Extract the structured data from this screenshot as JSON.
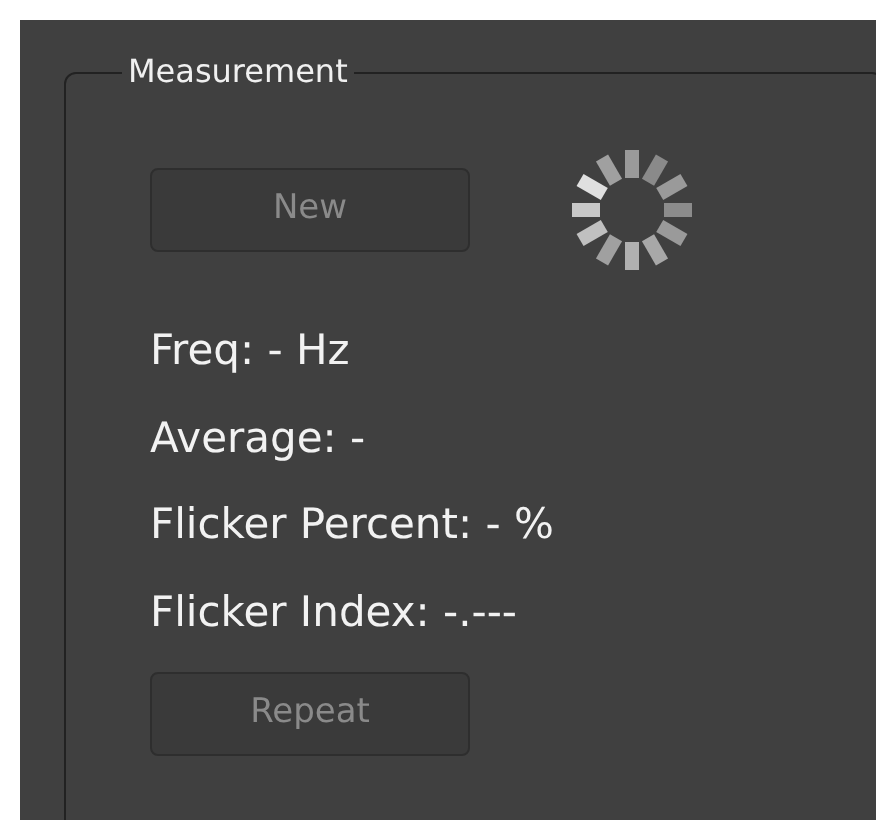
{
  "group": {
    "title": "Measurement"
  },
  "new_button": {
    "label": "New",
    "disabled": true
  },
  "readings": [
    "Freq: - Hz",
    "Average: -",
    "Flicker Percent: - %",
    "Flicker Index: -.---"
  ],
  "repeat_button": {
    "label": "Repeat",
    "disabled": true
  }
}
